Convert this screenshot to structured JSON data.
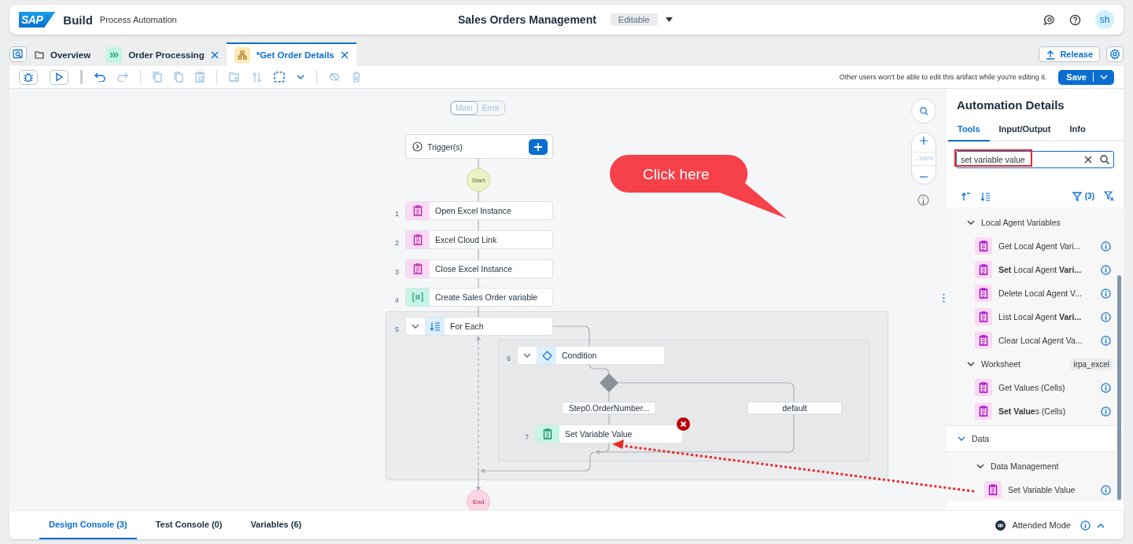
{
  "header": {
    "logo": "SAP",
    "product": "Build",
    "subtitle": "Process Automation",
    "title": "Sales Orders Management",
    "status": "Editable",
    "avatar": "sh"
  },
  "tabs": [
    {
      "label": "Overview",
      "kind": "folder",
      "selected": false,
      "closable": false
    },
    {
      "label": "Order Processing",
      "kind": "process",
      "selected": false,
      "closable": true
    },
    {
      "label": "*Get Order Details",
      "kind": "automation",
      "selected": true,
      "closable": true
    }
  ],
  "release_button": "Release",
  "toolbar": {
    "notice": "Other users won't be able to edit this artifact while you're editing it.",
    "save_button": "Save"
  },
  "canvas": {
    "views": [
      {
        "label": "Main",
        "selected": true
      },
      {
        "label": "Error",
        "selected": false
      }
    ],
    "trigger": "Trigger(s)",
    "start": "Start",
    "end": "End",
    "zoom": "⌄100%",
    "steps": [
      {
        "number": "1",
        "label": "Open Excel Instance",
        "kind": "excel",
        "error": false
      },
      {
        "number": "2",
        "label": "Excel Cloud Link",
        "kind": "excel",
        "error": false
      },
      {
        "number": "3",
        "label": "Close Excel Instance",
        "kind": "excel",
        "error": false
      },
      {
        "number": "4",
        "label": "Create Sales Order variable",
        "kind": "variable",
        "error": false
      },
      {
        "number": "5",
        "label": "For Each",
        "kind": "loop",
        "expanded": true,
        "error": false
      },
      {
        "number": "6",
        "label": "Condition",
        "kind": "condition",
        "expanded": true,
        "error": false
      },
      {
        "number": "7",
        "label": "Set Variable Value",
        "kind": "setter",
        "error": true
      }
    ],
    "branches": [
      "Step0.OrderNumber...",
      "default"
    ]
  },
  "callout": "Click here",
  "panel": {
    "title": "Automation Details",
    "tabs": [
      {
        "label": "Tools",
        "selected": true
      },
      {
        "label": "Input/Output",
        "selected": false
      },
      {
        "label": "Info",
        "selected": false
      }
    ],
    "search": {
      "value": "set variable value"
    },
    "filter_count": "(3)",
    "tree": [
      {
        "kind": "group",
        "label": "Local Agent Variables",
        "expanded": true,
        "children": [
          {
            "kind": "tool",
            "label": "Get Local Agent Vari..."
          },
          {
            "kind": "tool",
            "label": "**Set** Local Agent **Vari...**"
          },
          {
            "kind": "tool",
            "label": "Delete Local Agent V..."
          },
          {
            "kind": "tool",
            "label": "List Local Agent **Vari...**"
          },
          {
            "kind": "tool",
            "label": "Clear Local Agent Va..."
          }
        ]
      },
      {
        "kind": "group",
        "label": "Worksheet",
        "badge": "irpa_excel",
        "expanded": true,
        "children": [
          {
            "kind": "tool",
            "label": "Get Values (Cells)"
          },
          {
            "kind": "tool",
            "label": "**Set Value**s (Cells)"
          }
        ]
      },
      {
        "kind": "category",
        "label": "Data",
        "expanded": true,
        "children": [
          {
            "kind": "group",
            "label": "Data Management",
            "expanded": true,
            "children": [
              {
                "kind": "tool",
                "label": "Set Variable Value"
              }
            ]
          }
        ]
      }
    ]
  },
  "console": {
    "tabs": [
      {
        "label": "Design Console (3)",
        "selected": true
      },
      {
        "label": "Test Console (0)",
        "selected": false
      },
      {
        "label": "Variables (6)",
        "selected": false
      }
    ],
    "mode": "Attended Mode"
  }
}
